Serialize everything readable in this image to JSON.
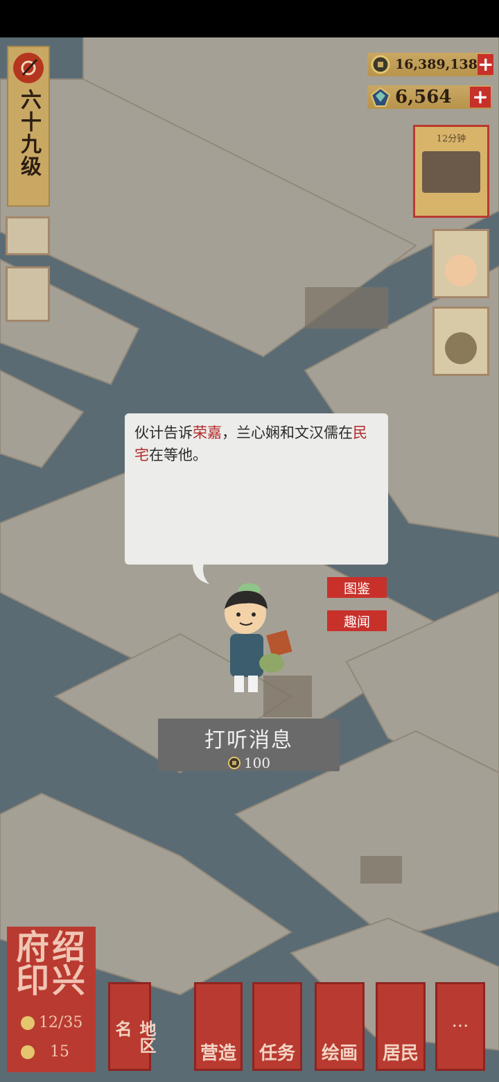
{
  "level": {
    "label": "六十九级"
  },
  "currency": {
    "coins": "16,389,138",
    "gems": "6,564",
    "add_label": "+"
  },
  "side": {
    "timer_label": "12分钟"
  },
  "dialog": {
    "seg1": "伙计告诉",
    "name1": "荣嘉",
    "seg2": "，兰心娴和文汉儒在",
    "place": "民宅",
    "seg3": "在等他。"
  },
  "tags": {
    "catalog": "图鉴",
    "anecdote": "趣闻"
  },
  "inquire": {
    "label": "打听消息",
    "cost": "100"
  },
  "seal": {
    "title": "绍兴府印",
    "progress": "12/35",
    "count": "15"
  },
  "bottom_bar": {
    "region": "地区名",
    "build": "营造",
    "tasks": "任务",
    "paint": "绘画",
    "residents": "居民",
    "more": "···"
  },
  "colors": {
    "accent_red": "#c8302a",
    "gold": "#c9a864",
    "water": "#6f8592"
  }
}
